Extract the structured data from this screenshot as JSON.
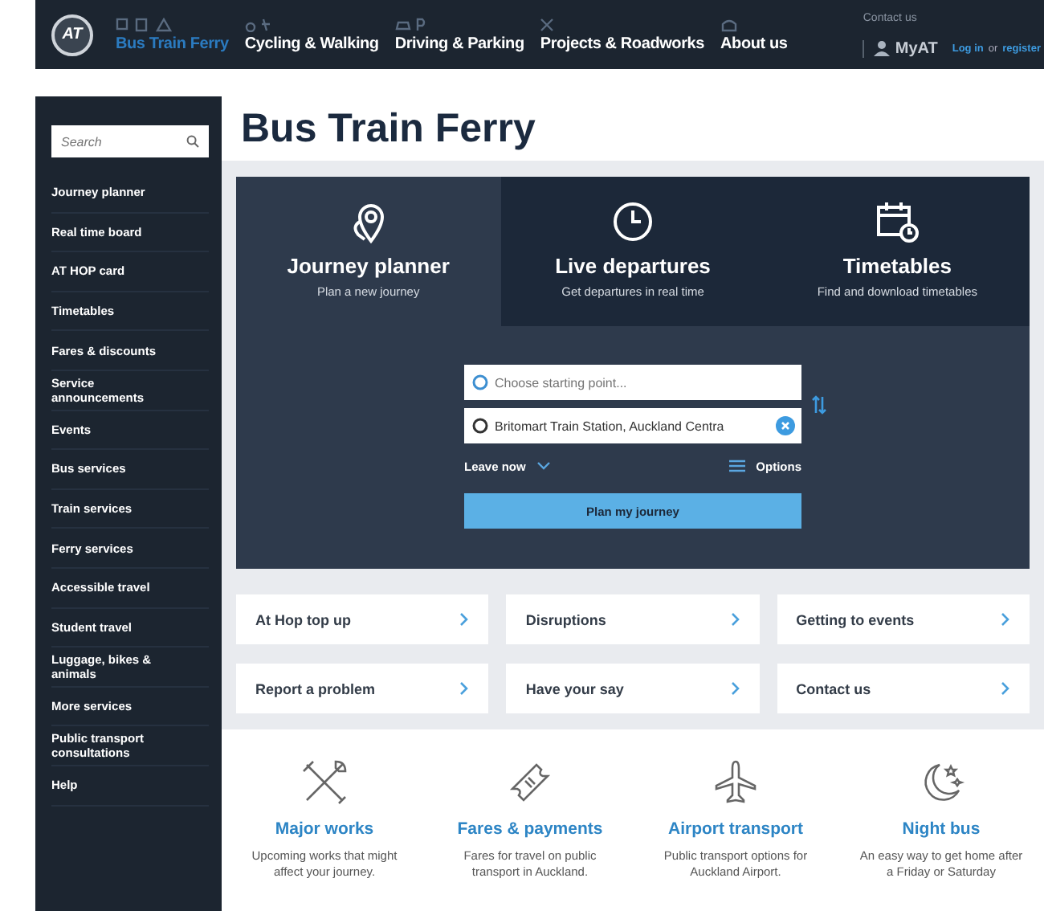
{
  "header": {
    "logo": "AT",
    "nav": [
      {
        "label": "Bus Train Ferry",
        "selected": true
      },
      {
        "label": "Cycling & Walking",
        "selected": false
      },
      {
        "label": "Driving & Parking",
        "selected": false
      },
      {
        "label": "Projects & Roadworks",
        "selected": false
      },
      {
        "label": "About us",
        "selected": false
      }
    ],
    "contact": "Contact us",
    "myat": "MyAT",
    "login": "Log in",
    "or": "or",
    "register": "register"
  },
  "sidebar": {
    "search": {
      "placeholder": "Search"
    },
    "items": [
      "Journey planner",
      "Real time board",
      "AT HOP card",
      "Timetables",
      "Fares & discounts",
      "Service announcements",
      "Events",
      "Bus services",
      "Train services",
      "Ferry services",
      "Accessible travel",
      "Student travel",
      "Luggage, bikes & animals",
      "More services",
      "Public transport consultations",
      "Help"
    ]
  },
  "page_title": "Bus Train Ferry",
  "tabs": [
    {
      "title": "Journey planner",
      "subtitle": "Plan a new journey",
      "selected": true
    },
    {
      "title": "Live departures",
      "subtitle": "Get departures in real time",
      "selected": false
    },
    {
      "title": "Timetables",
      "subtitle": "Find and download timetables",
      "selected": false
    }
  ],
  "planner": {
    "from": {
      "placeholder": "Choose starting point..."
    },
    "to": {
      "value": "Britomart Train Station, Auckland Centra"
    },
    "when": "Leave now",
    "options": "Options",
    "submit": "Plan my journey"
  },
  "links": [
    "At Hop top up",
    "Disruptions",
    "Getting to events",
    "Report a problem",
    "Have your say",
    "Contact us"
  ],
  "features": [
    {
      "title": "Major works",
      "text": "Upcoming works that might affect your journey."
    },
    {
      "title": "Fares & payments",
      "text": "Fares for travel on public transport in Auckland."
    },
    {
      "title": "Airport transport",
      "text": "Public transport options for Auckland Airport."
    },
    {
      "title": "Night bus",
      "text": "An easy way to get home after a Friday or Saturday"
    }
  ]
}
